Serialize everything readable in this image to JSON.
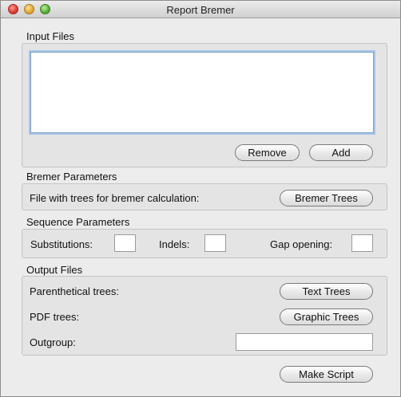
{
  "window": {
    "title": "Report Bremer"
  },
  "input_files": {
    "label": "Input Files",
    "files": [],
    "remove_label": "Remove",
    "add_label": "Add"
  },
  "bremer": {
    "label": "Bremer Parameters",
    "file_label": "File with trees for bremer calculation:",
    "button_label": "Bremer Trees"
  },
  "sequence": {
    "label": "Sequence Parameters",
    "substitutions_label": "Substitutions:",
    "substitutions_value": "",
    "indels_label": "Indels:",
    "indels_value": "",
    "gap_label": "Gap opening:",
    "gap_value": ""
  },
  "output": {
    "label": "Output Files",
    "parenthetical_label": "Parenthetical trees:",
    "text_trees_label": "Text Trees",
    "pdf_label": "PDF trees:",
    "graphic_trees_label": "Graphic Trees",
    "outgroup_label": "Outgroup:",
    "outgroup_value": ""
  },
  "footer": {
    "make_script_label": "Make Script"
  }
}
